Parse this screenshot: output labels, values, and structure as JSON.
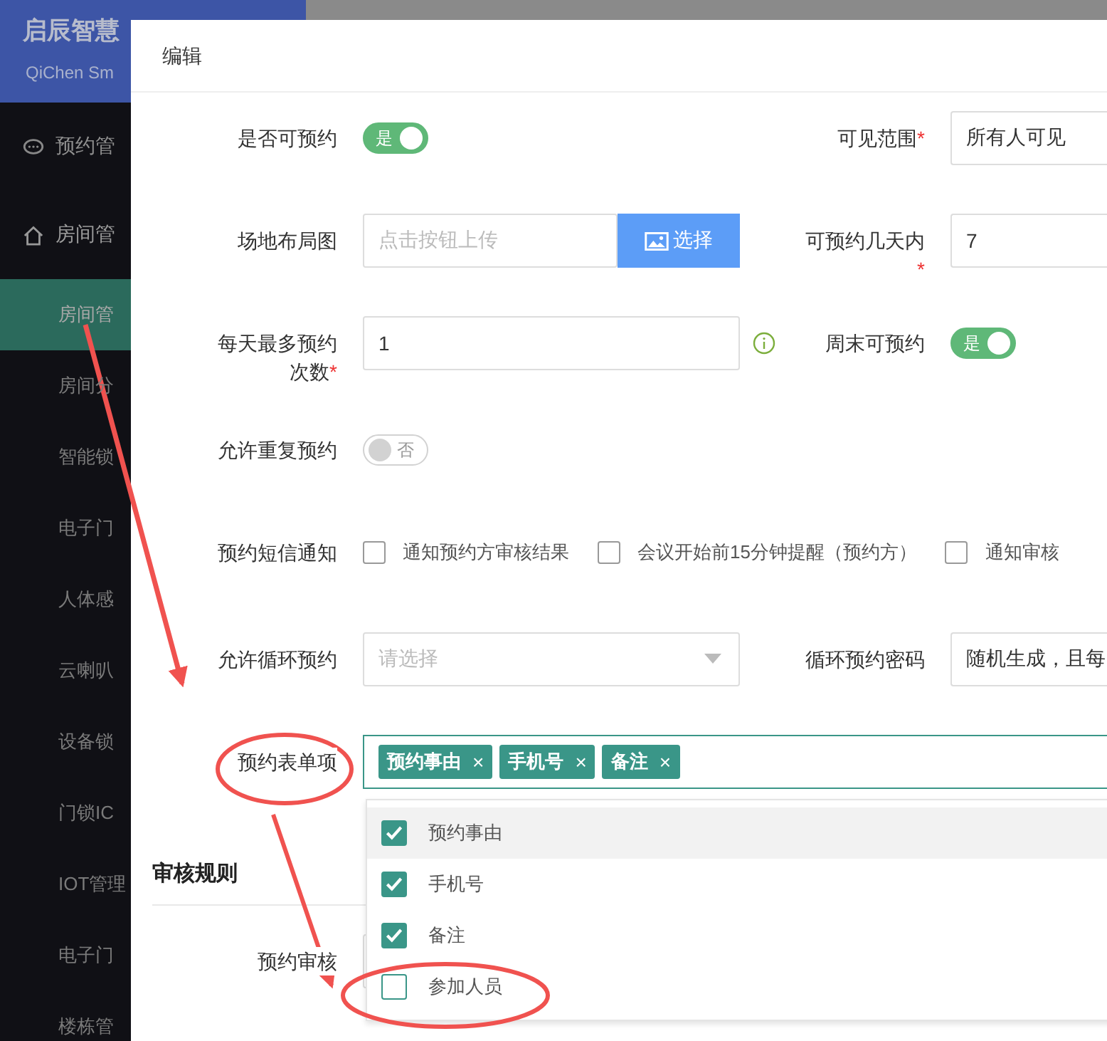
{
  "brand": {
    "title": "启辰智慧",
    "subtitle": "QiChen Sm"
  },
  "sidebar": {
    "items": [
      {
        "label": "预约管",
        "selected": false
      },
      {
        "label": "房间管",
        "selected": false,
        "expanded": true,
        "children": [
          {
            "label": "房间管",
            "selected": true
          },
          {
            "label": "房间分",
            "selected": false
          },
          {
            "label": "智能锁",
            "selected": false
          },
          {
            "label": "电子门",
            "selected": false
          },
          {
            "label": "人体感",
            "selected": false
          },
          {
            "label": "云喇叭",
            "selected": false
          },
          {
            "label": "设备锁",
            "selected": false
          },
          {
            "label": "门锁IC",
            "selected": false
          },
          {
            "label": "IOT管理",
            "selected": false
          },
          {
            "label": "电子门",
            "selected": false
          },
          {
            "label": "楼栋管",
            "selected": false
          }
        ]
      }
    ]
  },
  "dialog": {
    "title": "编辑",
    "rows": [
      {
        "fields": [
          {
            "kind": "toggle",
            "label": "是否可预约",
            "on": true,
            "text": "是"
          },
          {
            "kind": "select",
            "label": "可见范围",
            "mark": "*",
            "value": "所有人可见"
          }
        ]
      },
      {
        "fields": [
          {
            "kind": "upload",
            "label": "场地布局图",
            "placeholder": "点击按钮上传",
            "button": "选择"
          },
          {
            "kind": "input",
            "label": "可预约几天内",
            "mark": "*",
            "value": "7"
          }
        ]
      },
      {
        "fields": [
          {
            "kind": "input",
            "label": "每天最多预约次数",
            "mark": "*",
            "value": "1",
            "info": true
          },
          {
            "kind": "toggle",
            "label": "周末可预约",
            "on": true,
            "text": "是"
          }
        ]
      },
      {
        "fields": [
          {
            "kind": "toggle",
            "label": "允许重复预约",
            "on": false,
            "text": "否"
          }
        ]
      },
      {
        "fields": [
          {
            "kind": "checkgroup",
            "label": "预约短信通知",
            "options": [
              {
                "label": "通知预约方审核结果",
                "checked": false
              },
              {
                "label": "会议开始前15分钟提醒（预约方）",
                "checked": false
              },
              {
                "label": "通知审核",
                "checked": false
              }
            ]
          }
        ]
      },
      {
        "fields": [
          {
            "kind": "select",
            "label": "允许循环预约",
            "placeholder": "请选择"
          },
          {
            "kind": "input",
            "label": "循环预约密码",
            "value": "随机生成，且每"
          }
        ]
      },
      {
        "fields": [
          {
            "kind": "tagselect",
            "label": "预约表单项",
            "tags": [
              "预约事由",
              "手机号",
              "备注"
            ],
            "close": "×",
            "options": [
              {
                "label": "预约事由",
                "checked": true,
                "highlighted": true
              },
              {
                "label": "手机号",
                "checked": true,
                "highlighted": false
              },
              {
                "label": "备注",
                "checked": true,
                "highlighted": false
              },
              {
                "label": "参加人员",
                "checked": false,
                "highlighted": false
              }
            ]
          }
        ]
      }
    ],
    "section": {
      "title": "审核规则",
      "rows": [
        {
          "fields": [
            {
              "kind": "select",
              "label": "预约审核"
            }
          ]
        }
      ]
    }
  }
}
